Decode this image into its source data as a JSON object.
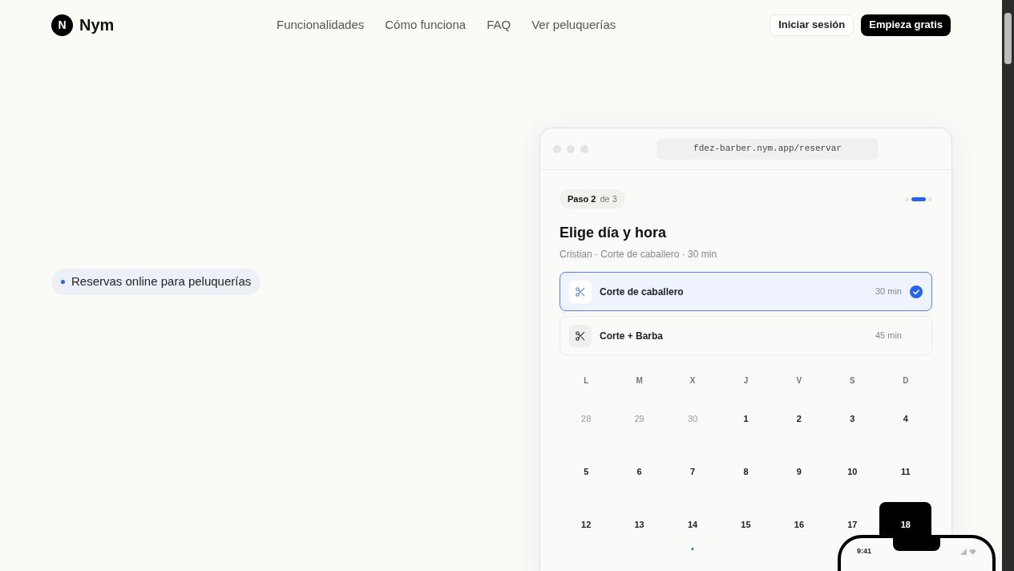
{
  "brand": {
    "logo_letter": "N",
    "name": "Nym"
  },
  "nav": {
    "links": [
      "Funcionalidades",
      "Cómo funciona",
      "FAQ",
      "Ver peluquerías"
    ],
    "login": "Iniciar sesión",
    "signup": "Empieza gratis"
  },
  "hero": {
    "badge": "Reservas online para peluquerías"
  },
  "mockup": {
    "url": "fdez-barber.nym.app/reservar",
    "step_label": "Paso 2",
    "step_of": "de 3",
    "step_dots": [
      {
        "selected": false
      },
      {
        "selected": true
      },
      {
        "selected": false
      }
    ],
    "title": "Elige día y hora",
    "subtitle": "Cristian · Corte de caballero · 30 min",
    "services": [
      {
        "name": "Corte de caballero",
        "duration": "30 min",
        "selected": true
      },
      {
        "name": "Corte + Barba",
        "duration": "45 min",
        "selected": false
      }
    ],
    "weekdays": [
      "L",
      "M",
      "X",
      "J",
      "V",
      "S",
      "D"
    ],
    "days": [
      {
        "label": "28",
        "outside_month": true,
        "selected": false,
        "has_dot": false
      },
      {
        "label": "29",
        "outside_month": true,
        "selected": false,
        "has_dot": false
      },
      {
        "label": "30",
        "outside_month": true,
        "selected": false,
        "has_dot": false
      },
      {
        "label": "1",
        "outside_month": false,
        "selected": false,
        "has_dot": false
      },
      {
        "label": "2",
        "outside_month": false,
        "selected": false,
        "has_dot": false
      },
      {
        "label": "3",
        "outside_month": false,
        "selected": false,
        "has_dot": false
      },
      {
        "label": "4",
        "outside_month": false,
        "selected": false,
        "has_dot": false
      },
      {
        "label": "5",
        "outside_month": false,
        "selected": false,
        "has_dot": false
      },
      {
        "label": "6",
        "outside_month": false,
        "selected": false,
        "has_dot": false
      },
      {
        "label": "7",
        "outside_month": false,
        "selected": false,
        "has_dot": false
      },
      {
        "label": "8",
        "outside_month": false,
        "selected": false,
        "has_dot": false
      },
      {
        "label": "9",
        "outside_month": false,
        "selected": false,
        "has_dot": false
      },
      {
        "label": "10",
        "outside_month": false,
        "selected": false,
        "has_dot": false
      },
      {
        "label": "11",
        "outside_month": false,
        "selected": false,
        "has_dot": false
      },
      {
        "label": "12",
        "outside_month": false,
        "selected": false,
        "has_dot": false
      },
      {
        "label": "13",
        "outside_month": false,
        "selected": false,
        "has_dot": false
      },
      {
        "label": "14",
        "outside_month": false,
        "selected": false,
        "has_dot": true
      },
      {
        "label": "15",
        "outside_month": false,
        "selected": false,
        "has_dot": false
      },
      {
        "label": "16",
        "outside_month": false,
        "selected": false,
        "has_dot": false
      },
      {
        "label": "17",
        "outside_month": false,
        "selected": false,
        "has_dot": false
      },
      {
        "label": "18",
        "outside_month": false,
        "selected": true,
        "has_dot": false
      }
    ]
  },
  "phone": {
    "time": "9:41"
  }
}
